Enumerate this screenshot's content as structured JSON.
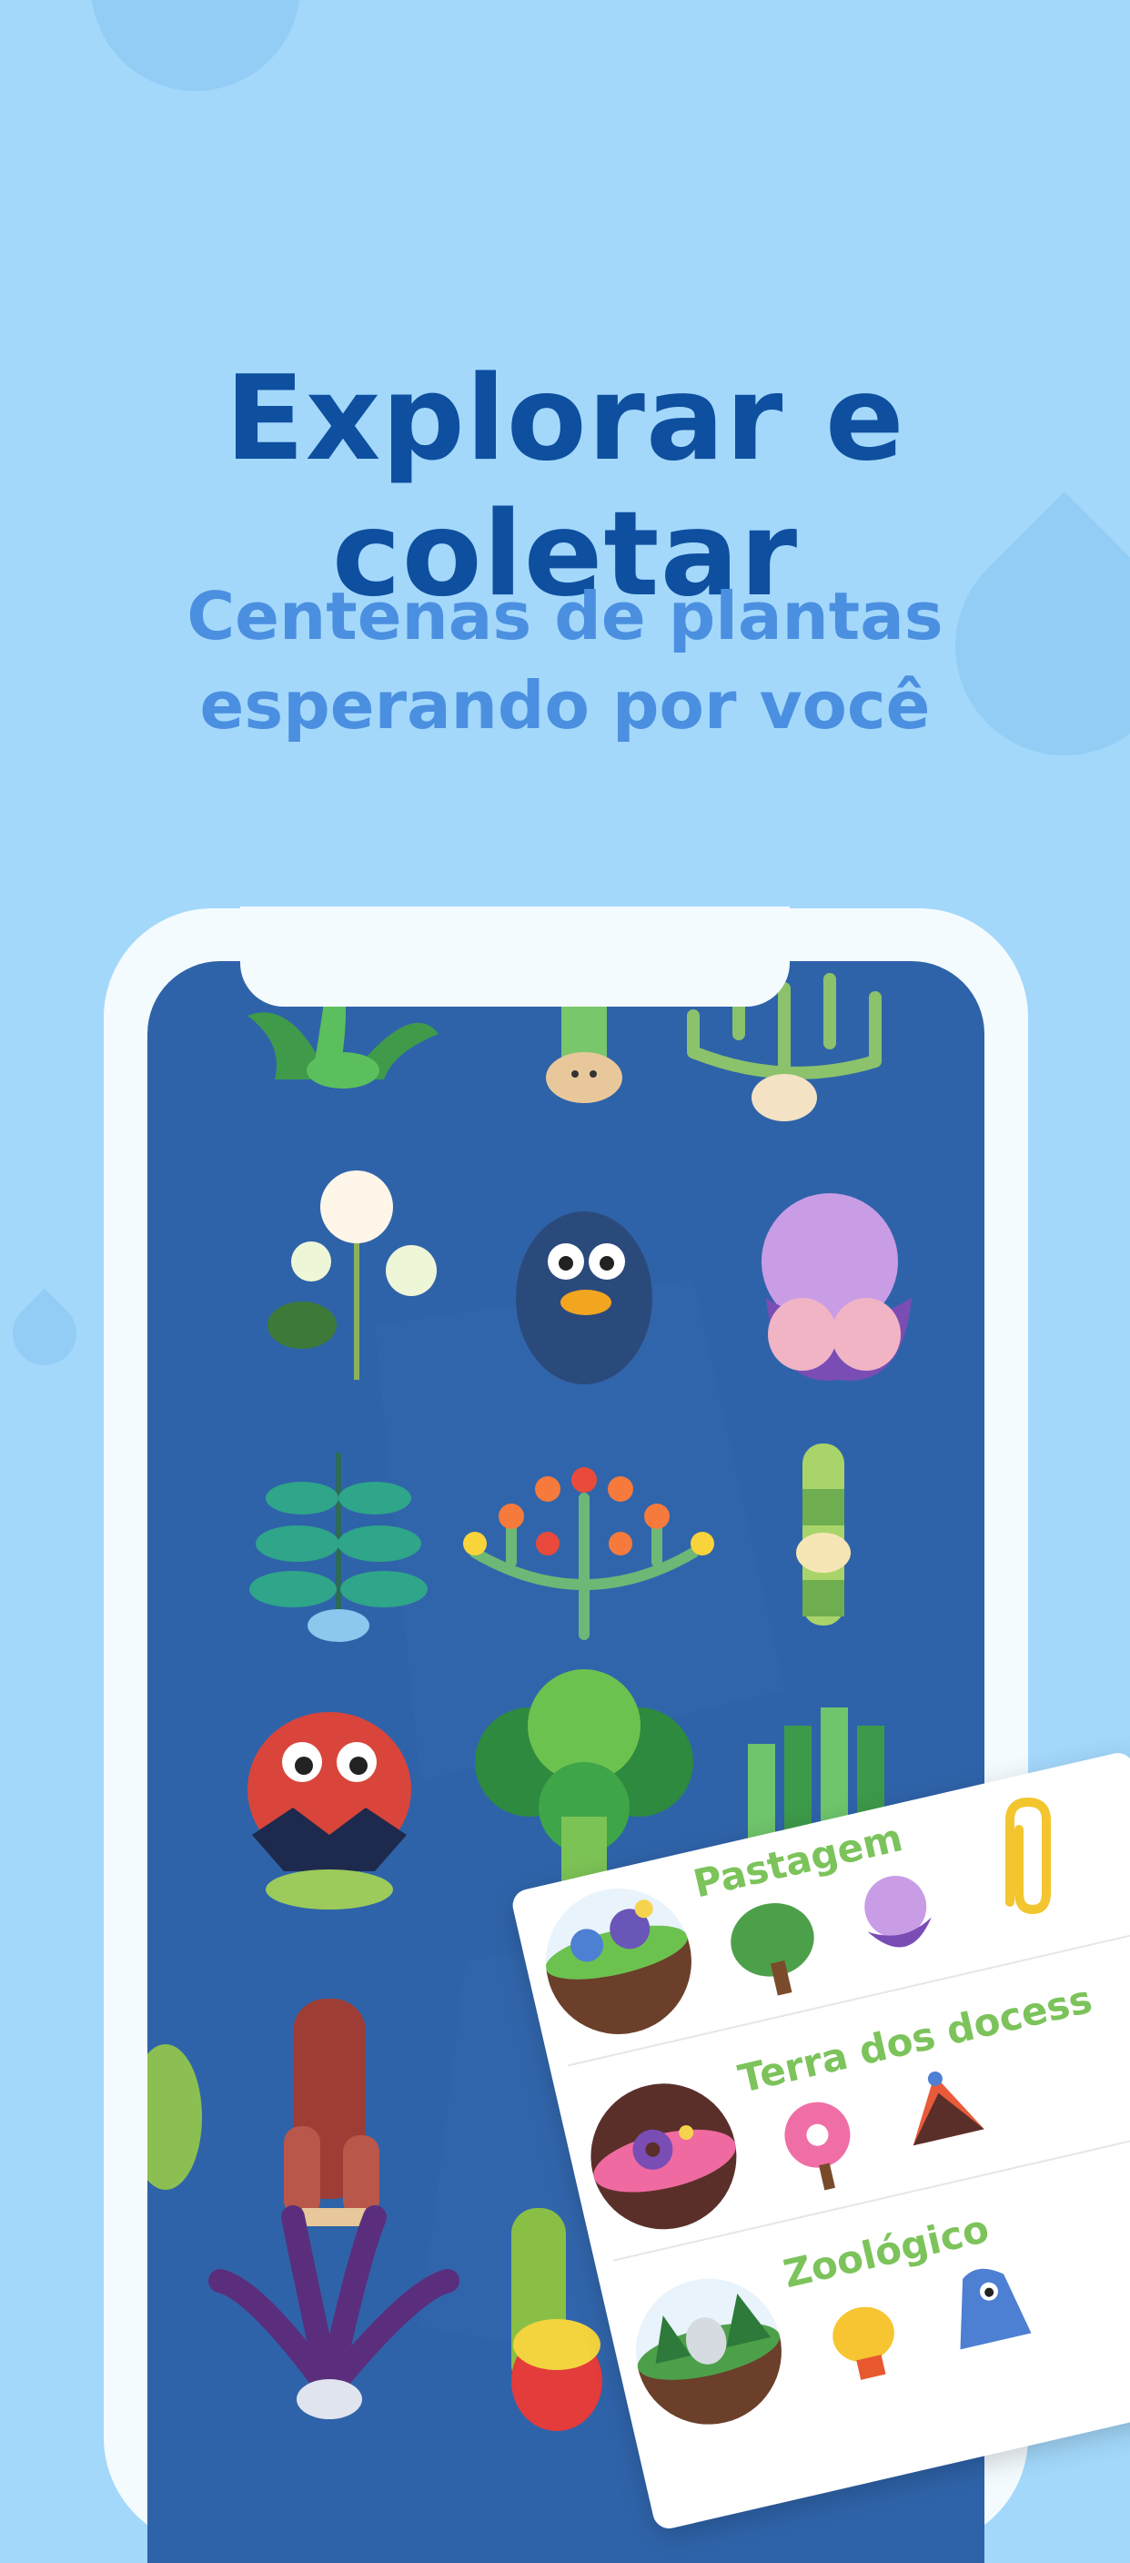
{
  "headline": "Explorar e coletar",
  "subheadline": {
    "line1": "Centenas de plantas",
    "line2": "esperando por você"
  },
  "colors": {
    "background": "#a3d8fb",
    "headline": "#0e4f9f",
    "subheadline": "#4b8fe0",
    "phone_frame": "#f4fbff",
    "screen": "#2f63a9",
    "card_title": "#7cc35b"
  },
  "worlds_card": {
    "items": [
      {
        "title": "Pastagem",
        "icon": "pasture-world-icon"
      },
      {
        "title": "Terra dos docess",
        "icon": "candy-world-icon"
      },
      {
        "title": "Zoológico",
        "icon": "zoo-world-icon"
      }
    ]
  },
  "icons": [
    "paperclip-icon",
    "plant-character-icon"
  ]
}
